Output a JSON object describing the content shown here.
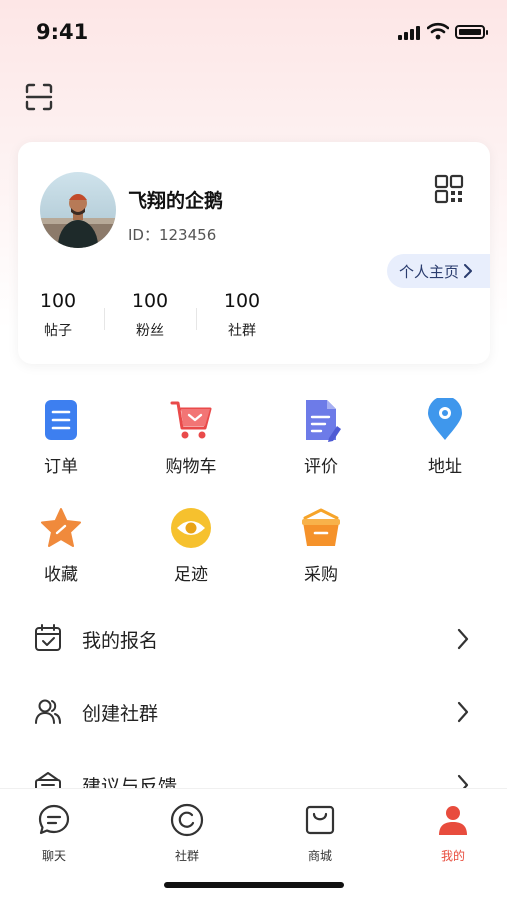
{
  "status_bar": {
    "time": "9:41"
  },
  "profile": {
    "username": "飞翔的企鹅",
    "user_id": "ID：123456",
    "homepage_label": "个人主页",
    "stats": [
      {
        "value": "100",
        "label": "帖子"
      },
      {
        "value": "100",
        "label": "粉丝"
      },
      {
        "value": "100",
        "label": "社群"
      }
    ]
  },
  "shortcuts": [
    {
      "label": "订单",
      "icon": "order-icon"
    },
    {
      "label": "购物车",
      "icon": "cart-icon"
    },
    {
      "label": "评价",
      "icon": "review-icon"
    },
    {
      "label": "地址",
      "icon": "location-icon"
    },
    {
      "label": "收藏",
      "icon": "star-icon"
    },
    {
      "label": "足迹",
      "icon": "eye-icon"
    },
    {
      "label": "采购",
      "icon": "basket-icon"
    }
  ],
  "menu": [
    {
      "label": "我的报名",
      "icon": "calendar-check-icon"
    },
    {
      "label": "创建社群",
      "icon": "users-icon"
    },
    {
      "label": "建议与反馈",
      "icon": "feedback-icon"
    }
  ],
  "tabs": [
    {
      "label": "聊天",
      "icon": "chat-icon",
      "active": false
    },
    {
      "label": "社群",
      "icon": "community-icon",
      "active": false
    },
    {
      "label": "商城",
      "icon": "shop-icon",
      "active": false
    },
    {
      "label": "我的",
      "icon": "profile-icon",
      "active": true
    }
  ],
  "colors": {
    "accent": "#e84c3d",
    "chip_bg": "#e8eefc"
  }
}
